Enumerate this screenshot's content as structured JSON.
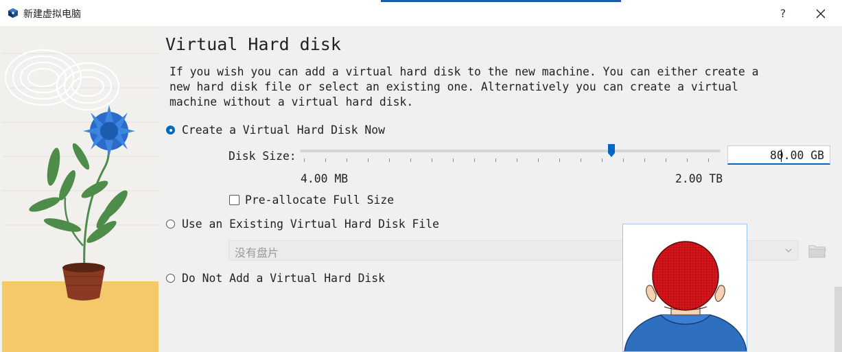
{
  "window": {
    "title": "新建虚拟电脑",
    "help_label": "?"
  },
  "page": {
    "heading": "Virtual Hard disk",
    "description": "If you wish you can add a virtual hard disk to the new machine. You can either create a\nnew hard disk file or select an existing one. Alternatively you can create a virtual\nmachine without a virtual hard disk."
  },
  "options": {
    "create_now": {
      "label": "Create a Virtual Hard Disk Now",
      "selected": true
    },
    "use_existing": {
      "label": "Use an Existing Virtual Hard Disk File",
      "selected": false
    },
    "do_not_add": {
      "label": "Do Not Add a Virtual Hard Disk",
      "selected": false
    }
  },
  "disk_size": {
    "label": "Disk Size:",
    "value": "80.00 GB",
    "min_label": "4.00 MB",
    "max_label": "2.00 TB",
    "slider_position": 0.74
  },
  "preallocate": {
    "label": "Pre-allocate Full Size",
    "checked": false
  },
  "existing_disk": {
    "selected": "没有盘片",
    "enabled": false
  },
  "colors": {
    "accent": "#0067c0",
    "dialog_bg": "#f0f0f0",
    "avatar_hair": "#c8151b",
    "avatar_shirt": "#2f6fc0"
  },
  "icons": {
    "app": "virtualbox-cube-icon",
    "close": "close-icon",
    "dropdown": "chevron-down-icon",
    "folder": "folder-icon"
  }
}
